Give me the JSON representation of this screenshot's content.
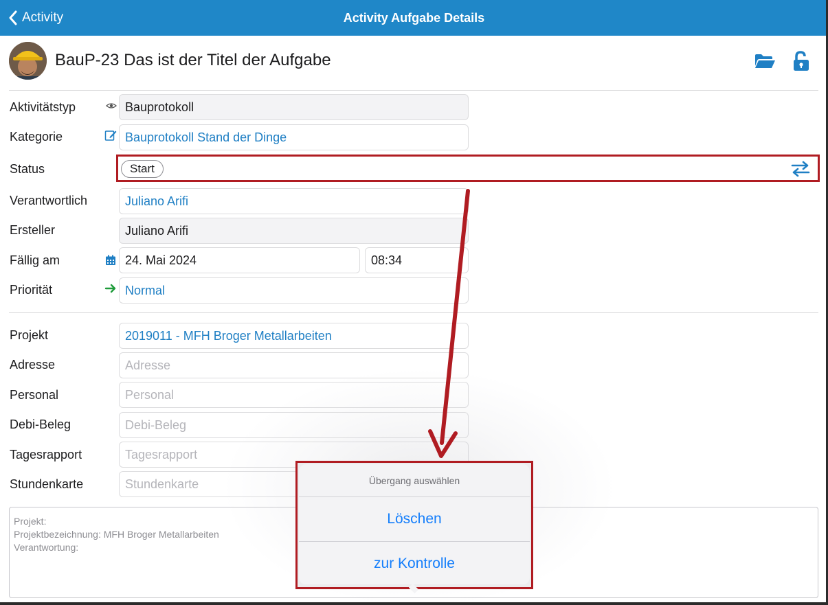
{
  "nav": {
    "back_label": "Activity",
    "title": "Activity Aufgabe Details"
  },
  "header": {
    "task_title": "BauP-23 Das ist der Titel der Aufgabe",
    "icons": [
      "folder-open-icon",
      "unlock-icon"
    ]
  },
  "form": {
    "aktivitaetstyp": {
      "label": "Aktivitätstyp",
      "value": "Bauprotokoll"
    },
    "kategorie": {
      "label": "Kategorie",
      "value": "Bauprotokoll Stand der Dinge"
    },
    "status": {
      "label": "Status",
      "value": "Start"
    },
    "verantwortlich": {
      "label": "Verantwortlich",
      "value": "Juliano Arifi"
    },
    "ersteller": {
      "label": "Ersteller",
      "value": "Juliano Arifi"
    },
    "faellig": {
      "label": "Fällig am",
      "date": "24. Mai 2024",
      "time": "08:34"
    },
    "prioritaet": {
      "label": "Priorität",
      "value": "Normal"
    },
    "projekt": {
      "label": "Projekt",
      "value": "2019011 - MFH Broger Metallarbeiten"
    },
    "adresse": {
      "label": "Adresse",
      "placeholder": "Adresse"
    },
    "personal": {
      "label": "Personal",
      "placeholder": "Personal"
    },
    "debi_beleg": {
      "label": "Debi-Beleg",
      "placeholder": "Debi-Beleg"
    },
    "tagesrapport": {
      "label": "Tagesrapport",
      "placeholder": "Tagesrapport"
    },
    "stundenkarte": {
      "label": "Stundenkarte",
      "placeholder": "Stundenkarte"
    }
  },
  "notes": {
    "line1": "Projekt:",
    "line2": "Projektbezeichnung: MFH Broger Metallarbeiten",
    "line3": "Verantwortung:"
  },
  "action_sheet": {
    "title": "Übergang auswählen",
    "buttons": [
      "Löschen",
      "zur Kontrolle"
    ]
  },
  "colors": {
    "nav_bar": "#1f87c8",
    "link": "#1f7fc4",
    "ios_blue": "#147efb",
    "annotation_red": "#b01c22",
    "priority_arrow": "#1e9b3a"
  }
}
